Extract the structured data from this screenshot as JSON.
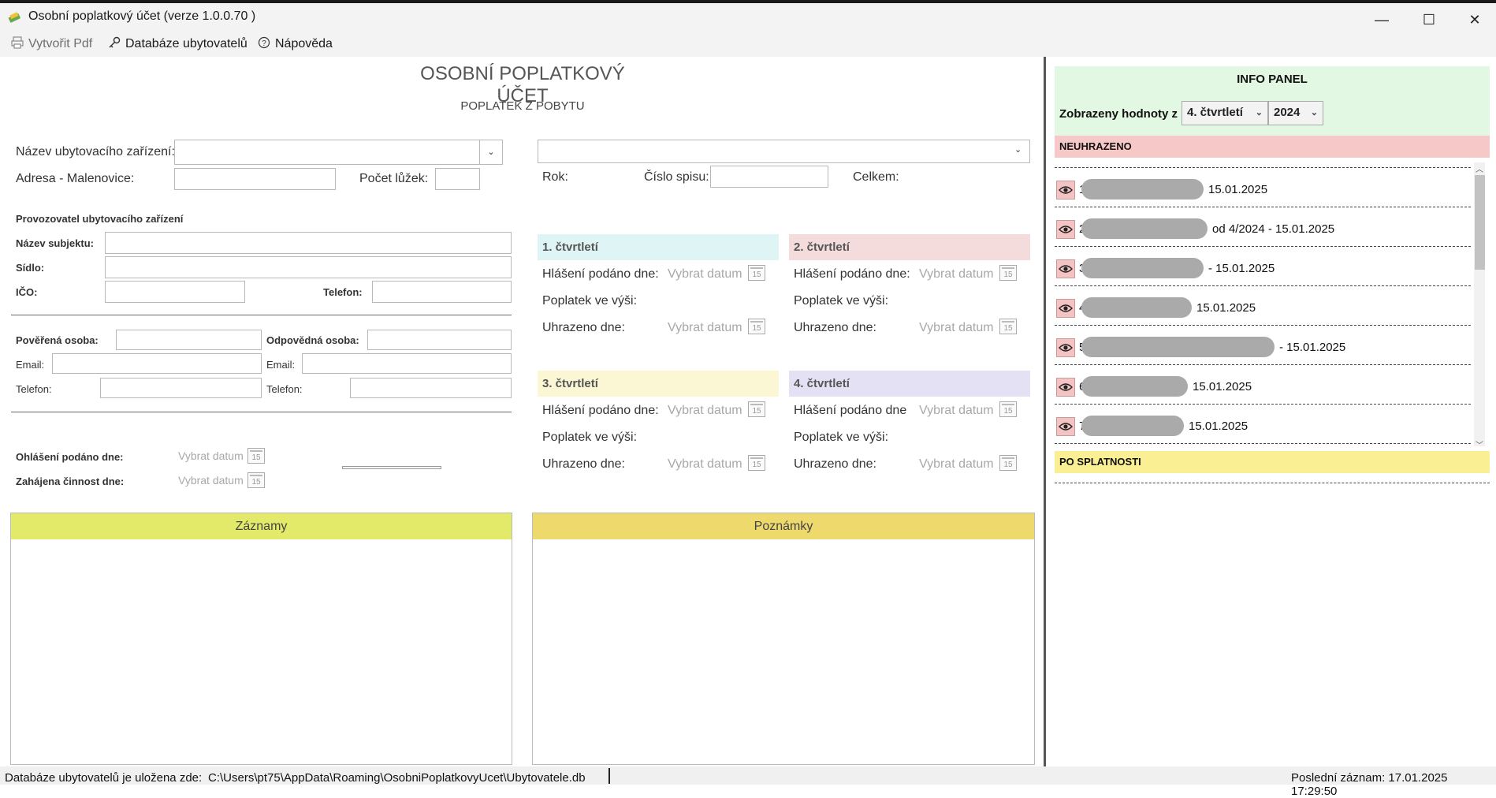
{
  "window": {
    "title": "Osobní poplatkový účet (verze 1.0.0.70 )",
    "minimize": "—",
    "maximize": "☐",
    "close": "✕"
  },
  "menu": {
    "create_pdf": "Vytvořit Pdf",
    "database": "Databáze ubytovatelů",
    "help": "Nápověda"
  },
  "form": {
    "title": "OSOBNÍ POPLATKOVÝ ÚČET",
    "subtitle": "POPLATEK Z POBYTU",
    "facility_name_label": "Název ubytovacího zařízení:",
    "address_label": "Adresa - Malenovice:",
    "beds_label": "Počet lůžek:",
    "operator_section": "Provozovatel ubytovacího zařízení",
    "subject_name_label": "Název subjektu:",
    "seat_label": "Sídlo:",
    "ico_label": "IČO:",
    "phone_label": "Telefon:",
    "authorized_person_label": "Pověřená osoba:",
    "responsible_person_label": "Odpovědná osoba:",
    "email_label": "Email:",
    "email_label_2": "Email:",
    "phone_label_2": "Telefon:",
    "phone_label_3": "Telefon:",
    "reported_label": "Ohlášení podáno dne:",
    "started_label": "Zahájena činnost dne:",
    "date_placeholder": "Vybrat datum",
    "year_label": "Rok:",
    "file_number_label": "Číslo spisu:",
    "total_label": "Celkem:"
  },
  "quarters": [
    {
      "title": "1. čtvrtletí",
      "report_label": "Hlášení podáno dne:",
      "fee_label": "Poplatek ve výši:",
      "paid_label": "Uhrazeno dne:",
      "color": "#dff4f4"
    },
    {
      "title": "2. čtvrtletí",
      "report_label": "Hlášení podáno dne:",
      "fee_label": "Poplatek ve výši:",
      "paid_label": "Uhrazeno dne:",
      "color": "#f4dcdc"
    },
    {
      "title": "3. čtvrtletí",
      "report_label": "Hlášení podáno dne:",
      "fee_label": "Poplatek ve výši:",
      "paid_label": "Uhrazeno dne:",
      "color": "#fbf7d4"
    },
    {
      "title": "4. čtvrtletí",
      "report_label": "Hlášení podáno dne",
      "fee_label": "Poplatek ve výši:",
      "paid_label": "Uhrazeno dne:",
      "color": "#e4e1f4"
    }
  ],
  "date_placeholder": "Vybrat datum",
  "panels": {
    "records": "Záznamy",
    "notes": "Poznámky",
    "records_color": "#e3ea6a",
    "notes_color": "#edd96c"
  },
  "info_panel": {
    "title": "INFO PANEL",
    "shown_label": "Zobrazeny hodnoty z",
    "quarter_value": "4. čtvrtletí",
    "year_value": "2024",
    "unpaid_header": "NEUHRAZENO",
    "overdue_header": "PO SPLATNOSTI",
    "items": [
      {
        "num": "1",
        "text": "15.01.2025"
      },
      {
        "num": "2",
        "text": "od 4/2024 - 15.01.2025"
      },
      {
        "num": "3",
        "text": "- 15.01.2025"
      },
      {
        "num": "4",
        "text": "15.01.2025"
      },
      {
        "num": "5",
        "text": "- 15.01.2025"
      },
      {
        "num": "6",
        "text": "15.01.2025"
      },
      {
        "num": "7",
        "text": "15.01.2025"
      }
    ]
  },
  "status": {
    "db_label": "Databáze ubytovatelů je uložena zde:",
    "db_path": "C:\\Users\\pt75\\AppData\\Roaming\\OsobniPoplatkovyUcet\\Ubytovatele.db",
    "last_record": "Poslední záznam: 17.01.2025 17:29:50"
  }
}
